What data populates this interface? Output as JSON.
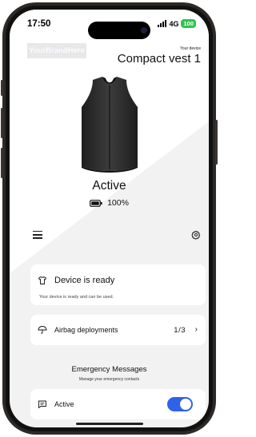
{
  "status_bar": {
    "time": "17:50",
    "network": "4G",
    "battery": "100"
  },
  "brand": {
    "logo_text": "YourBrandHere"
  },
  "device": {
    "caption": "Your device",
    "name": "Compact vest 1"
  },
  "vest": {
    "state": "Active",
    "battery": "100%"
  },
  "toolbar": {
    "menu_icon": "hamburger-menu-icon",
    "settings_icon": "gear-icon"
  },
  "ready_card": {
    "title": "Device is ready",
    "subtitle": "Your device is ready and can be used.",
    "icon": "shirt-icon"
  },
  "airbag": {
    "label": "Airbag deployments",
    "count": "1/3",
    "icon": "umbrella-icon"
  },
  "emergency": {
    "title": "Emergency Messages",
    "subtitle": "Manage your emergency contacts"
  },
  "messages": {
    "label": "Active",
    "toggle_on": true,
    "icon": "message-icon"
  },
  "colors": {
    "accent": "#2f62e6",
    "battery_badge": "#31c24d",
    "background": "#f2f2f3"
  }
}
